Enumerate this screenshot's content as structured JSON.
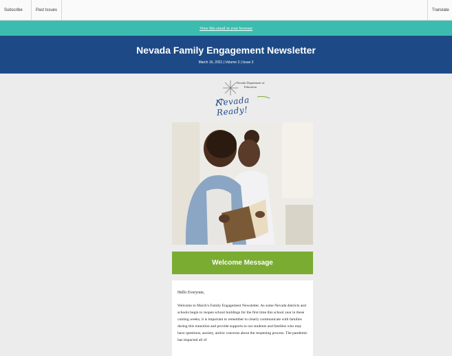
{
  "topbar": {
    "subscribe": "Subscribe",
    "past_issues": "Past Issues",
    "translate": "Translate"
  },
  "browser_link": "View this email in your browser",
  "header": {
    "title": "Nevada Family Engagement Newsletter",
    "subtitle": "March 16, 2021 | Volume 3 | Issue 3"
  },
  "logo": {
    "department": "Nevada Department of Education",
    "tagline": "Nevada Ready!"
  },
  "section": {
    "heading": "Welcome Message"
  },
  "letter": {
    "greeting": "Hello Everyone,",
    "body": "Welcome to March's Family Engagement Newsletter. As some Nevada districts and schools begin to reopen school buildings for the first time this school year in these coming weeks, it is important to remember to clearly communicate with families during this transition and provide supports to our students and families who may have questions, anxiety, and/or concerns about the reopening process. The pandemic has impacted all of"
  },
  "colors": {
    "browser_bar": "#3bbcae",
    "header_bg": "#1d4a86",
    "section_bar": "#7aac32",
    "page_bg": "#ececec"
  }
}
